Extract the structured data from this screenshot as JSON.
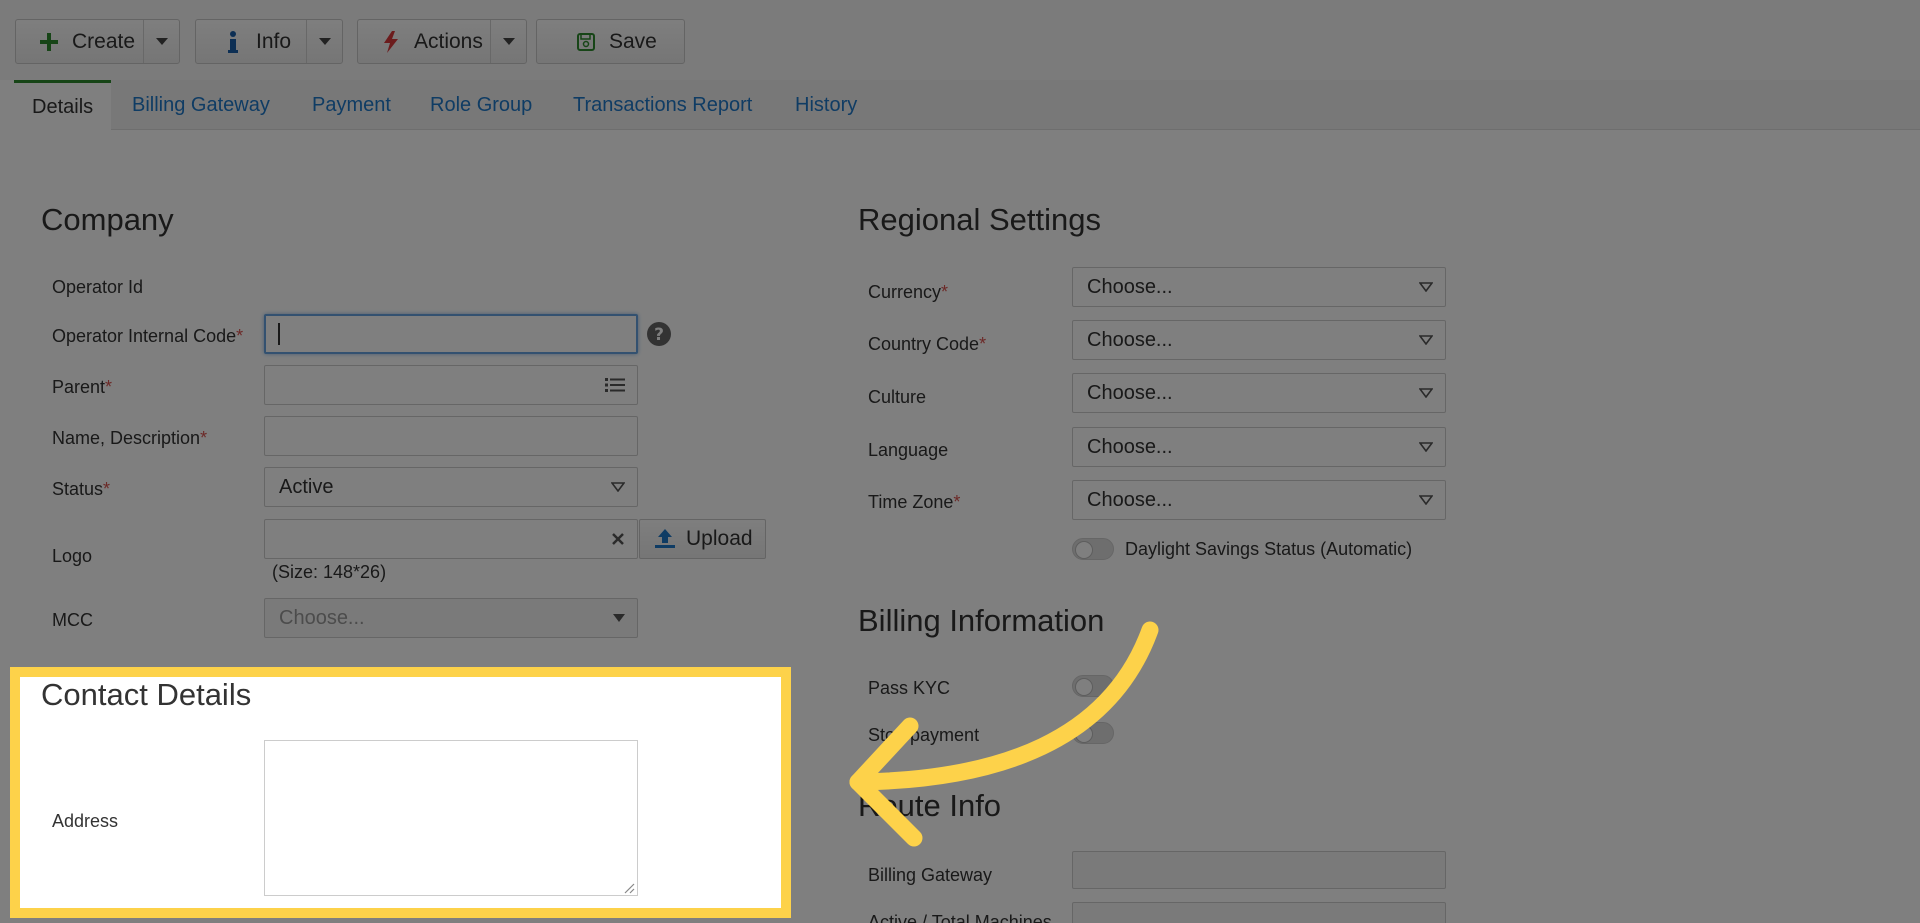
{
  "toolbar": {
    "create_label": "Create",
    "info_label": "Info",
    "actions_label": "Actions",
    "save_label": "Save"
  },
  "tabs": [
    {
      "label": "Details",
      "active": true
    },
    {
      "label": "Billing Gateway"
    },
    {
      "label": "Payment"
    },
    {
      "label": "Role Group"
    },
    {
      "label": "Transactions Report"
    },
    {
      "label": "History"
    }
  ],
  "company": {
    "title": "Company",
    "operator_id_label": "Operator Id",
    "operator_internal_code_label": "Operator Internal Code",
    "operator_internal_code_value": "",
    "parent_label": "Parent",
    "parent_value": "",
    "name_label": "Name, Description",
    "name_value": "",
    "status_label": "Status",
    "status_value": "Active",
    "logo_label": "Logo",
    "logo_value": "",
    "upload_label": "Upload",
    "logo_size_hint": "(Size: 148*26)",
    "mcc_label": "MCC",
    "mcc_placeholder": "Choose..."
  },
  "contact": {
    "title": "Contact Details",
    "address_label": "Address",
    "address_value": ""
  },
  "regional": {
    "title": "Regional Settings",
    "currency_label": "Currency",
    "currency_value": "Choose...",
    "country_code_label": "Country Code",
    "country_code_value": "Choose...",
    "culture_label": "Culture",
    "culture_value": "Choose...",
    "language_label": "Language",
    "language_value": "Choose...",
    "time_zone_label": "Time Zone",
    "time_zone_value": "Choose...",
    "dst_label": "Daylight Savings Status (Automatic)"
  },
  "billing": {
    "title": "Billing Information",
    "pass_kyc_label": "Pass KYC",
    "stop_payment_label": "Stop payment"
  },
  "route": {
    "title": "Route Info",
    "billing_gateway_label": "Billing Gateway",
    "billing_gateway_value": "",
    "active_total_machines_label": "Active / Total Machines"
  },
  "colors": {
    "highlight": "#fdd24a",
    "dim_overlay": "rgba(0,0,0,0.5)",
    "link": "#1f78c8",
    "active_tab_accent": "#2e8b2e",
    "required": "#d9534f"
  }
}
